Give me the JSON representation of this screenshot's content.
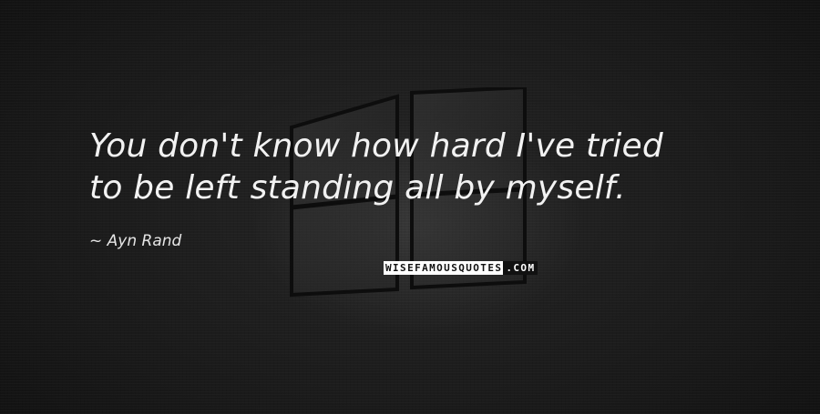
{
  "quote": {
    "lines": [
      "You don't know how hard I've tried",
      "to be left standing all by myself."
    ]
  },
  "author": {
    "label": "~ Ayn Rand"
  },
  "watermark": {
    "part_a": "WISEFAMOUSQUOTES",
    "part_b": ".COM"
  },
  "colors": {
    "background": "#161616",
    "text": "#f2f2f2"
  }
}
